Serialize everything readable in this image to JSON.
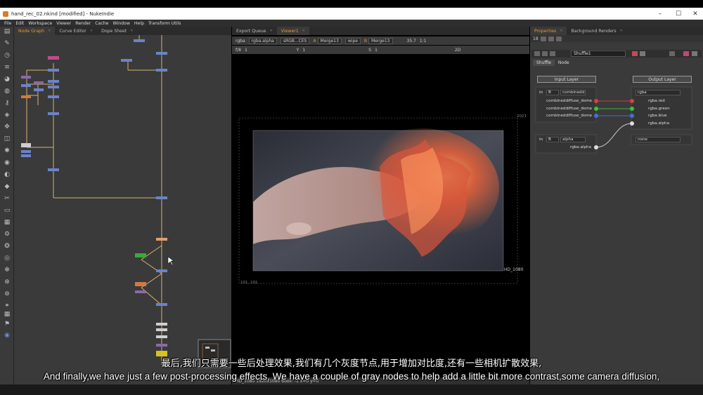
{
  "window": {
    "title": "hand_rec_02.nkind [modified] - NukeIndie",
    "minimize": "–",
    "maximize": "☐",
    "close": "✕"
  },
  "menu": [
    "File",
    "Edit",
    "Workspace",
    "Viewer",
    "Render",
    "Cache",
    "Window",
    "Help",
    "Transform Utils"
  ],
  "left_panel": {
    "tabs": [
      "Node Graph",
      "Curve Editor",
      "Dope Sheet"
    ],
    "active_tab": "Node Graph"
  },
  "viewer": {
    "tabs": [
      "Export Queue",
      "Viewer1"
    ],
    "active_tab": "Viewer1",
    "channels": "rgba",
    "channel_sel": "rgba.alpha",
    "colorspace": "sRGB...CES",
    "input_a": "A",
    "input_a_node": "Merge13",
    "wipe": "wipe",
    "input_b": "B",
    "input_b_node": "Merge13",
    "zoom": "35.7",
    "ratio": "1:1",
    "view_mode": "2D",
    "fstop": "f/8",
    "frame": "1",
    "y_label": "Y",
    "y_value": "1",
    "s_label": "S",
    "s_value": "1",
    "format_label": "HD_1080",
    "corner_tr": "2021",
    "corner_bl": "101, 101",
    "footer": "HD_1080 1920x1080  bbox: -1  x=0 y=0"
  },
  "properties": {
    "tabs": [
      "Properties",
      "Background Renders"
    ],
    "count": "18",
    "node_name": "Shuffle1",
    "subtabs": [
      "Shuffle",
      "Node"
    ],
    "input_layer": "Input Layer",
    "output_layer": "Output Layer",
    "in_label": "In",
    "in_a_input": "B",
    "in_a_layer": "combinedd",
    "in_b_input": "B",
    "in_b_layer": "alpha",
    "out_a_layer": "rgba",
    "out_b_layer": "none",
    "in_channels": [
      "combineddiffuse_dome",
      "combineddiffuse_dome",
      "combineddiffuse_dome"
    ],
    "in_b_channel": "rgba.alpha",
    "out_channels": [
      "rgba.red",
      "rgba.green",
      "rgba.blue",
      "rgba.alpha"
    ]
  },
  "subtitles": {
    "zh": "最后,我们只需要一些后处理效果,我们有几个灰度节点,用于增加对比度,还有一些相机扩散效果,",
    "en": "And finally,we have just a few post-processing effects, We have a couple of gray nodes to help add a little bit more contrast,some camera diffusion,"
  },
  "colors": {
    "accent": "#e8952a",
    "panel_bg": "#3a3a3a",
    "node_blue": "#6a84c8",
    "node_purple": "#8a6aa8",
    "node_pink": "#c04a8a",
    "node_orange": "#d07a40",
    "node_green": "#3aa83a",
    "node_yellow": "#d8c020",
    "wire": "#d8b070",
    "fire": "#e0603a"
  }
}
